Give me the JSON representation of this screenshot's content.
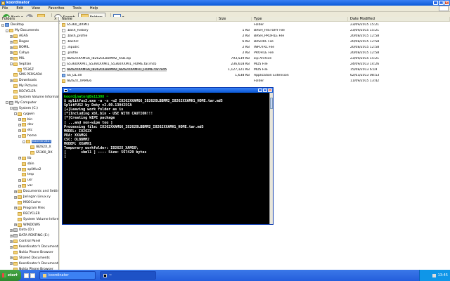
{
  "window": {
    "title": "koordinator"
  },
  "menu": [
    "File",
    "Edit",
    "View",
    "Favorites",
    "Tools",
    "Help"
  ],
  "toolbar": {
    "back": "Back",
    "search": "Search",
    "folders": "Folders"
  },
  "address": {
    "label": "Address",
    "value": "C:\\cygwin\\home\\koordinator",
    "go": "Go"
  },
  "folders_panel": {
    "title": "Folders",
    "tree": [
      {
        "label": "Desktop",
        "depth": 0,
        "pm": "-",
        "icon": "blue"
      },
      {
        "label": "My Documents",
        "depth": 1,
        "pm": "-",
        "icon": "folder"
      },
      {
        "label": "AGAS",
        "depth": 2,
        "pm": "+",
        "icon": "folder"
      },
      {
        "label": "Bagas",
        "depth": 2,
        "pm": "+",
        "icon": "folder"
      },
      {
        "label": "BOMIL",
        "depth": 2,
        "pm": "+",
        "icon": "folder"
      },
      {
        "label": "Cahyo",
        "depth": 2,
        "pm": "+",
        "icon": "folder"
      },
      {
        "label": "MIL",
        "depth": 2,
        "pm": "+",
        "icon": "folder"
      },
      {
        "label": "Septian",
        "depth": 2,
        "pm": "-",
        "icon": "folder"
      },
      {
        "label": "5536Z",
        "depth": 3,
        "pm": "",
        "icon": "folder"
      },
      {
        "label": "SMS PERSADA",
        "depth": 2,
        "pm": "",
        "icon": "folder"
      },
      {
        "label": "Downloads",
        "depth": 2,
        "pm": "+",
        "icon": "folder"
      },
      {
        "label": "My Pictures",
        "depth": 2,
        "pm": "",
        "icon": "folder"
      },
      {
        "label": "RECYCLER",
        "depth": 2,
        "pm": "",
        "icon": "folder"
      },
      {
        "label": "System Volume Informati",
        "depth": 2,
        "pm": "",
        "icon": "folder"
      },
      {
        "label": "My Computer",
        "depth": 1,
        "pm": "-",
        "icon": "drive"
      },
      {
        "label": "System (C:)",
        "depth": 2,
        "pm": "-",
        "icon": "drive"
      },
      {
        "label": "cygwin",
        "depth": 3,
        "pm": "-",
        "icon": "folder"
      },
      {
        "label": "bin",
        "depth": 4,
        "pm": "+",
        "icon": "folder"
      },
      {
        "label": "dev",
        "depth": 4,
        "pm": "+",
        "icon": "folder"
      },
      {
        "label": "etc",
        "depth": 4,
        "pm": "+",
        "icon": "folder"
      },
      {
        "label": "home",
        "depth": 4,
        "pm": "-",
        "icon": "folder"
      },
      {
        "label": "koordinator",
        "depth": 5,
        "pm": "-",
        "icon": "folder",
        "selected": true
      },
      {
        "label": "I8262X_X",
        "depth": 6,
        "pm": "",
        "icon": "folder"
      },
      {
        "label": "S5360_DX",
        "depth": 6,
        "pm": "",
        "icon": "folder"
      },
      {
        "label": "lib",
        "depth": 4,
        "pm": "+",
        "icon": "folder"
      },
      {
        "label": "sbin",
        "depth": 4,
        "pm": "",
        "icon": "folder"
      },
      {
        "label": "splitfus2",
        "depth": 4,
        "pm": "+",
        "icon": "folder"
      },
      {
        "label": "tmp",
        "depth": 4,
        "pm": "",
        "icon": "folder"
      },
      {
        "label": "usr",
        "depth": 4,
        "pm": "+",
        "icon": "folder"
      },
      {
        "label": "var",
        "depth": 4,
        "pm": "+",
        "icon": "folder"
      },
      {
        "label": "Documents and Settin",
        "depth": 3,
        "pm": "+",
        "icon": "folder"
      },
      {
        "label": "Jaringan Linux.ry",
        "depth": 3,
        "pm": "+",
        "icon": "folder"
      },
      {
        "label": "MSOCache",
        "depth": 3,
        "pm": "",
        "icon": "folder"
      },
      {
        "label": "Program Files",
        "depth": 3,
        "pm": "+",
        "icon": "folder"
      },
      {
        "label": "RECYCLER",
        "depth": 3,
        "pm": "",
        "icon": "folder"
      },
      {
        "label": "System Volume Inform",
        "depth": 3,
        "pm": "",
        "icon": "folder"
      },
      {
        "label": "WINDOWS",
        "depth": 3,
        "pm": "+",
        "icon": "folder"
      },
      {
        "label": "Data (D:)",
        "depth": 2,
        "pm": "+",
        "icon": "drive"
      },
      {
        "label": "DATA PENTING (E:)",
        "depth": 2,
        "pm": "+",
        "icon": "drive"
      },
      {
        "label": "Control Panel",
        "depth": 2,
        "pm": "+",
        "icon": "folder"
      },
      {
        "label": "Koordinator's Documents",
        "depth": 2,
        "pm": "+",
        "icon": "folder"
      },
      {
        "label": "Nokia Phone Browser",
        "depth": 2,
        "pm": "",
        "icon": "folder"
      },
      {
        "label": "Shared Documents",
        "depth": 2,
        "pm": "+",
        "icon": "folder"
      },
      {
        "label": "Koordinator's Documents",
        "depth": 2,
        "pm": "+",
        "icon": "folder"
      },
      {
        "label": "Nokia Phone Browser",
        "depth": 2,
        "pm": "",
        "icon": "folder"
      },
      {
        "label": "My Network Places",
        "depth": 1,
        "pm": "+",
        "icon": "blue"
      }
    ]
  },
  "file_list": {
    "columns": [
      "Name",
      "Size",
      "Type",
      "Date Modified"
    ],
    "rows": [
      {
        "name": "S5360_DXMI1",
        "size": "",
        "type": "Folder",
        "date": "23/09/2015 15:21",
        "icon": "folder"
      },
      {
        "name": ".bash_history",
        "size": "1 KB",
        "type": "BASH_HISTORY File",
        "date": "23/09/2015 15:21",
        "icon": "file"
      },
      {
        "name": ".bash_profile",
        "size": "2 KB",
        "type": "BASH_PROFILE File",
        "date": "20/08/2015 12:58",
        "icon": "file"
      },
      {
        "name": ".bashrc",
        "size": "6 KB",
        "type": "BASHRC File",
        "date": "20/08/2015 12:58",
        "icon": "file"
      },
      {
        "name": ".inputrc",
        "size": "2 KB",
        "type": "INPUTRC File",
        "date": "20/08/2015 12:58",
        "icon": "file"
      },
      {
        "name": ".profile",
        "size": "2 KB",
        "type": "PROFILE File",
        "date": "20/08/2015 12:58",
        "icon": "file"
      },
      {
        "name": "I8262XXAMG6_I8262OLBBMM2_XSB.zip",
        "size": "793,539 KB",
        "type": "zip Archive",
        "date": "23/09/2015 15:21",
        "icon": "file"
      },
      {
        "name": "S5360XXMI1_S5360XXMI1_S5360XXMI1_HOME.tar.md5",
        "size": "236,618 KB",
        "type": "MD5 File",
        "date": "24/09/2013 14:26",
        "icon": "file"
      },
      {
        "name": "I8262XXAMG6_I8262OLBBMM2_I8262XXAMH1_HOME.tar.md5",
        "size": "1,127,121 KB",
        "type": "MD5 File",
        "date": "15/08/2013 6:19",
        "icon": "file",
        "selected": true
      },
      {
        "name": "SS_DL.dll",
        "size": "1,638 KB",
        "type": "Application Extension",
        "date": "02/03/2013 08:53",
        "icon": "app"
      },
      {
        "name": "I8262X_XAMG6",
        "size": "",
        "type": "Folder",
        "date": "11/09/2015 13:42",
        "icon": "folder"
      }
    ]
  },
  "console": {
    "title": "~",
    "lines": [
      {
        "cls": "prompt",
        "text": "koordinator@Ds11308 ~"
      },
      {
        "cls": "",
        "text": "$ splitfus2.exe -a -s -w2 I8262XXAMG6_I8262OLBBMM2_I8262XXAMH1_HOME.tar.md5"
      },
      {
        "cls": "",
        "text": "SplitFUS2 by Doky v2.00.130425CA"
      },
      {
        "cls": "",
        "text": "[+]Leaving work folder as is"
      },
      {
        "cls": "",
        "text": "[*]Including xbl.bin - USE WITH CAUTION!!!"
      },
      {
        "cls": "",
        "text": "[*]Creating WIPE package"
      },
      {
        "cls": "",
        "text": "[ ...and non-wipe too ]"
      },
      {
        "cls": "",
        "text": "Processing file: I8262XXAMG6_I8262OLBBMM2_I8262XXAMH1_HOME.tar.md5"
      },
      {
        "cls": "",
        "text": "MODEL: I8262X"
      },
      {
        "cls": "",
        "text": "PDA: XXAMG6"
      },
      {
        "cls": "",
        "text": "CSC: OLBBMM2"
      },
      {
        "cls": "",
        "text": "MODEM: XXAMH1"
      },
      {
        "cls": "",
        "text": "Temporary workfolder: I8262X_XAMG6\\"
      },
      {
        "cls": "",
        "text": "[       sbml1 ] ---- Size: 567420 bytes"
      },
      {
        "cls": "",
        "text": "[          "
      }
    ]
  },
  "taskbar": {
    "start": "start",
    "tasks": [
      {
        "label": "koordinator",
        "icon": "folder",
        "active": false
      },
      {
        "label": "~",
        "icon": "cmd",
        "active": true
      }
    ],
    "clock": "13:45"
  }
}
